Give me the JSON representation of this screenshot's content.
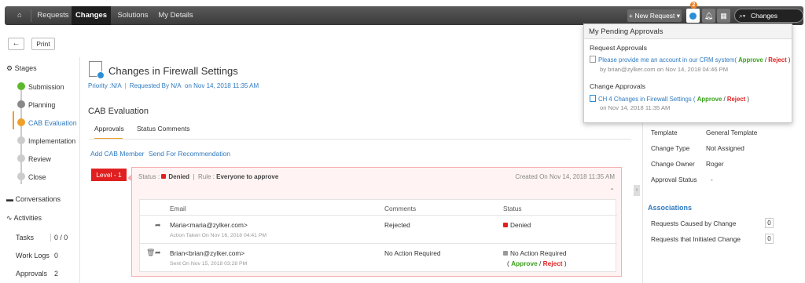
{
  "nav": {
    "home_icon": "home-icon",
    "tabs": [
      "Requests",
      "Changes",
      "Solutions",
      "My Details"
    ],
    "active_tab": "Changes",
    "new_request_label": "+ New Request ▾",
    "approvals_badge": "2",
    "search_label": "Changes"
  },
  "toolbar": {
    "back_icon": "←",
    "print_label": "Print"
  },
  "sidebar": {
    "stages_heading": "Stages",
    "stages": [
      "Submission",
      "Planning",
      "CAB Evaluation",
      "Implementation",
      "Review",
      "Close"
    ],
    "conversations_label": "Conversations",
    "activities_label": "Activities",
    "counts": [
      {
        "label": "Tasks",
        "value": "0 / 0"
      },
      {
        "label": "Work Logs",
        "value": "0"
      },
      {
        "label": "Approvals",
        "value": "2"
      }
    ]
  },
  "change": {
    "title": "Changes in Firewall Settings",
    "priority": "Priority :N/A",
    "requested_by": "Requested By N/A",
    "requested_on": "on Nov 14, 2018 11:35 AM"
  },
  "cab": {
    "title": "CAB Evaluation",
    "tabs": [
      "Approvals",
      "Status Comments"
    ],
    "links": [
      "Add CAB Member",
      "Send For Recommendation"
    ],
    "level_label": "Level - 1",
    "status_prefix": "Status :",
    "status_value": "Denied",
    "rule_prefix": "Rule :",
    "rule_value": "Everyone to approve",
    "created": "Created On Nov 14, 2018 11:35 AM",
    "columns": [
      "Email",
      "Comments",
      "Status"
    ],
    "rows": [
      {
        "email": "Maria<maria@zylker.com>",
        "sub": "Action Taken On Nov 16, 2018 04:41 PM",
        "comment": "Rejected",
        "status": "Denied"
      },
      {
        "email": "Brian<brian@zylker.com>",
        "sub": "Sent On Nov 15, 2018 03:28 PM",
        "comment": "No Action Required",
        "status": "No Action Required",
        "approve": "Approve",
        "slash": "/",
        "reject": "Reject"
      }
    ]
  },
  "properties": [
    {
      "label": "Template",
      "value": "General Template"
    },
    {
      "label": "Change Type",
      "value": "Not Assigned"
    },
    {
      "label": "Change Owner",
      "value": "Roger"
    },
    {
      "label": "Approval Status",
      "value": "-"
    }
  ],
  "associations": {
    "heading": "Associations",
    "items": [
      {
        "label": "Requests Caused by Change",
        "value": "0"
      },
      {
        "label": "Requests that Initiated Change",
        "value": "0"
      }
    ]
  },
  "pending": {
    "heading": "My Pending Approvals",
    "request_section": "Request Approvals",
    "request_item": "Please provide me an account in our CRM system(",
    "request_meta": "by brian@zylker.com on Nov 14, 2018 04:46 PM",
    "change_section": "Change Approvals",
    "change_item": "CH 4 Changes in Firewall Settings (",
    "change_meta": "on Nov 14, 2018 11:35 AM",
    "approve": "Approve",
    "slash": "/",
    "reject": "Reject",
    "close_paren": ")"
  },
  "colors": {
    "accent": "#f0a02a",
    "link": "#2f7ac0",
    "danger": "#e02020",
    "success": "#3aa01c"
  }
}
